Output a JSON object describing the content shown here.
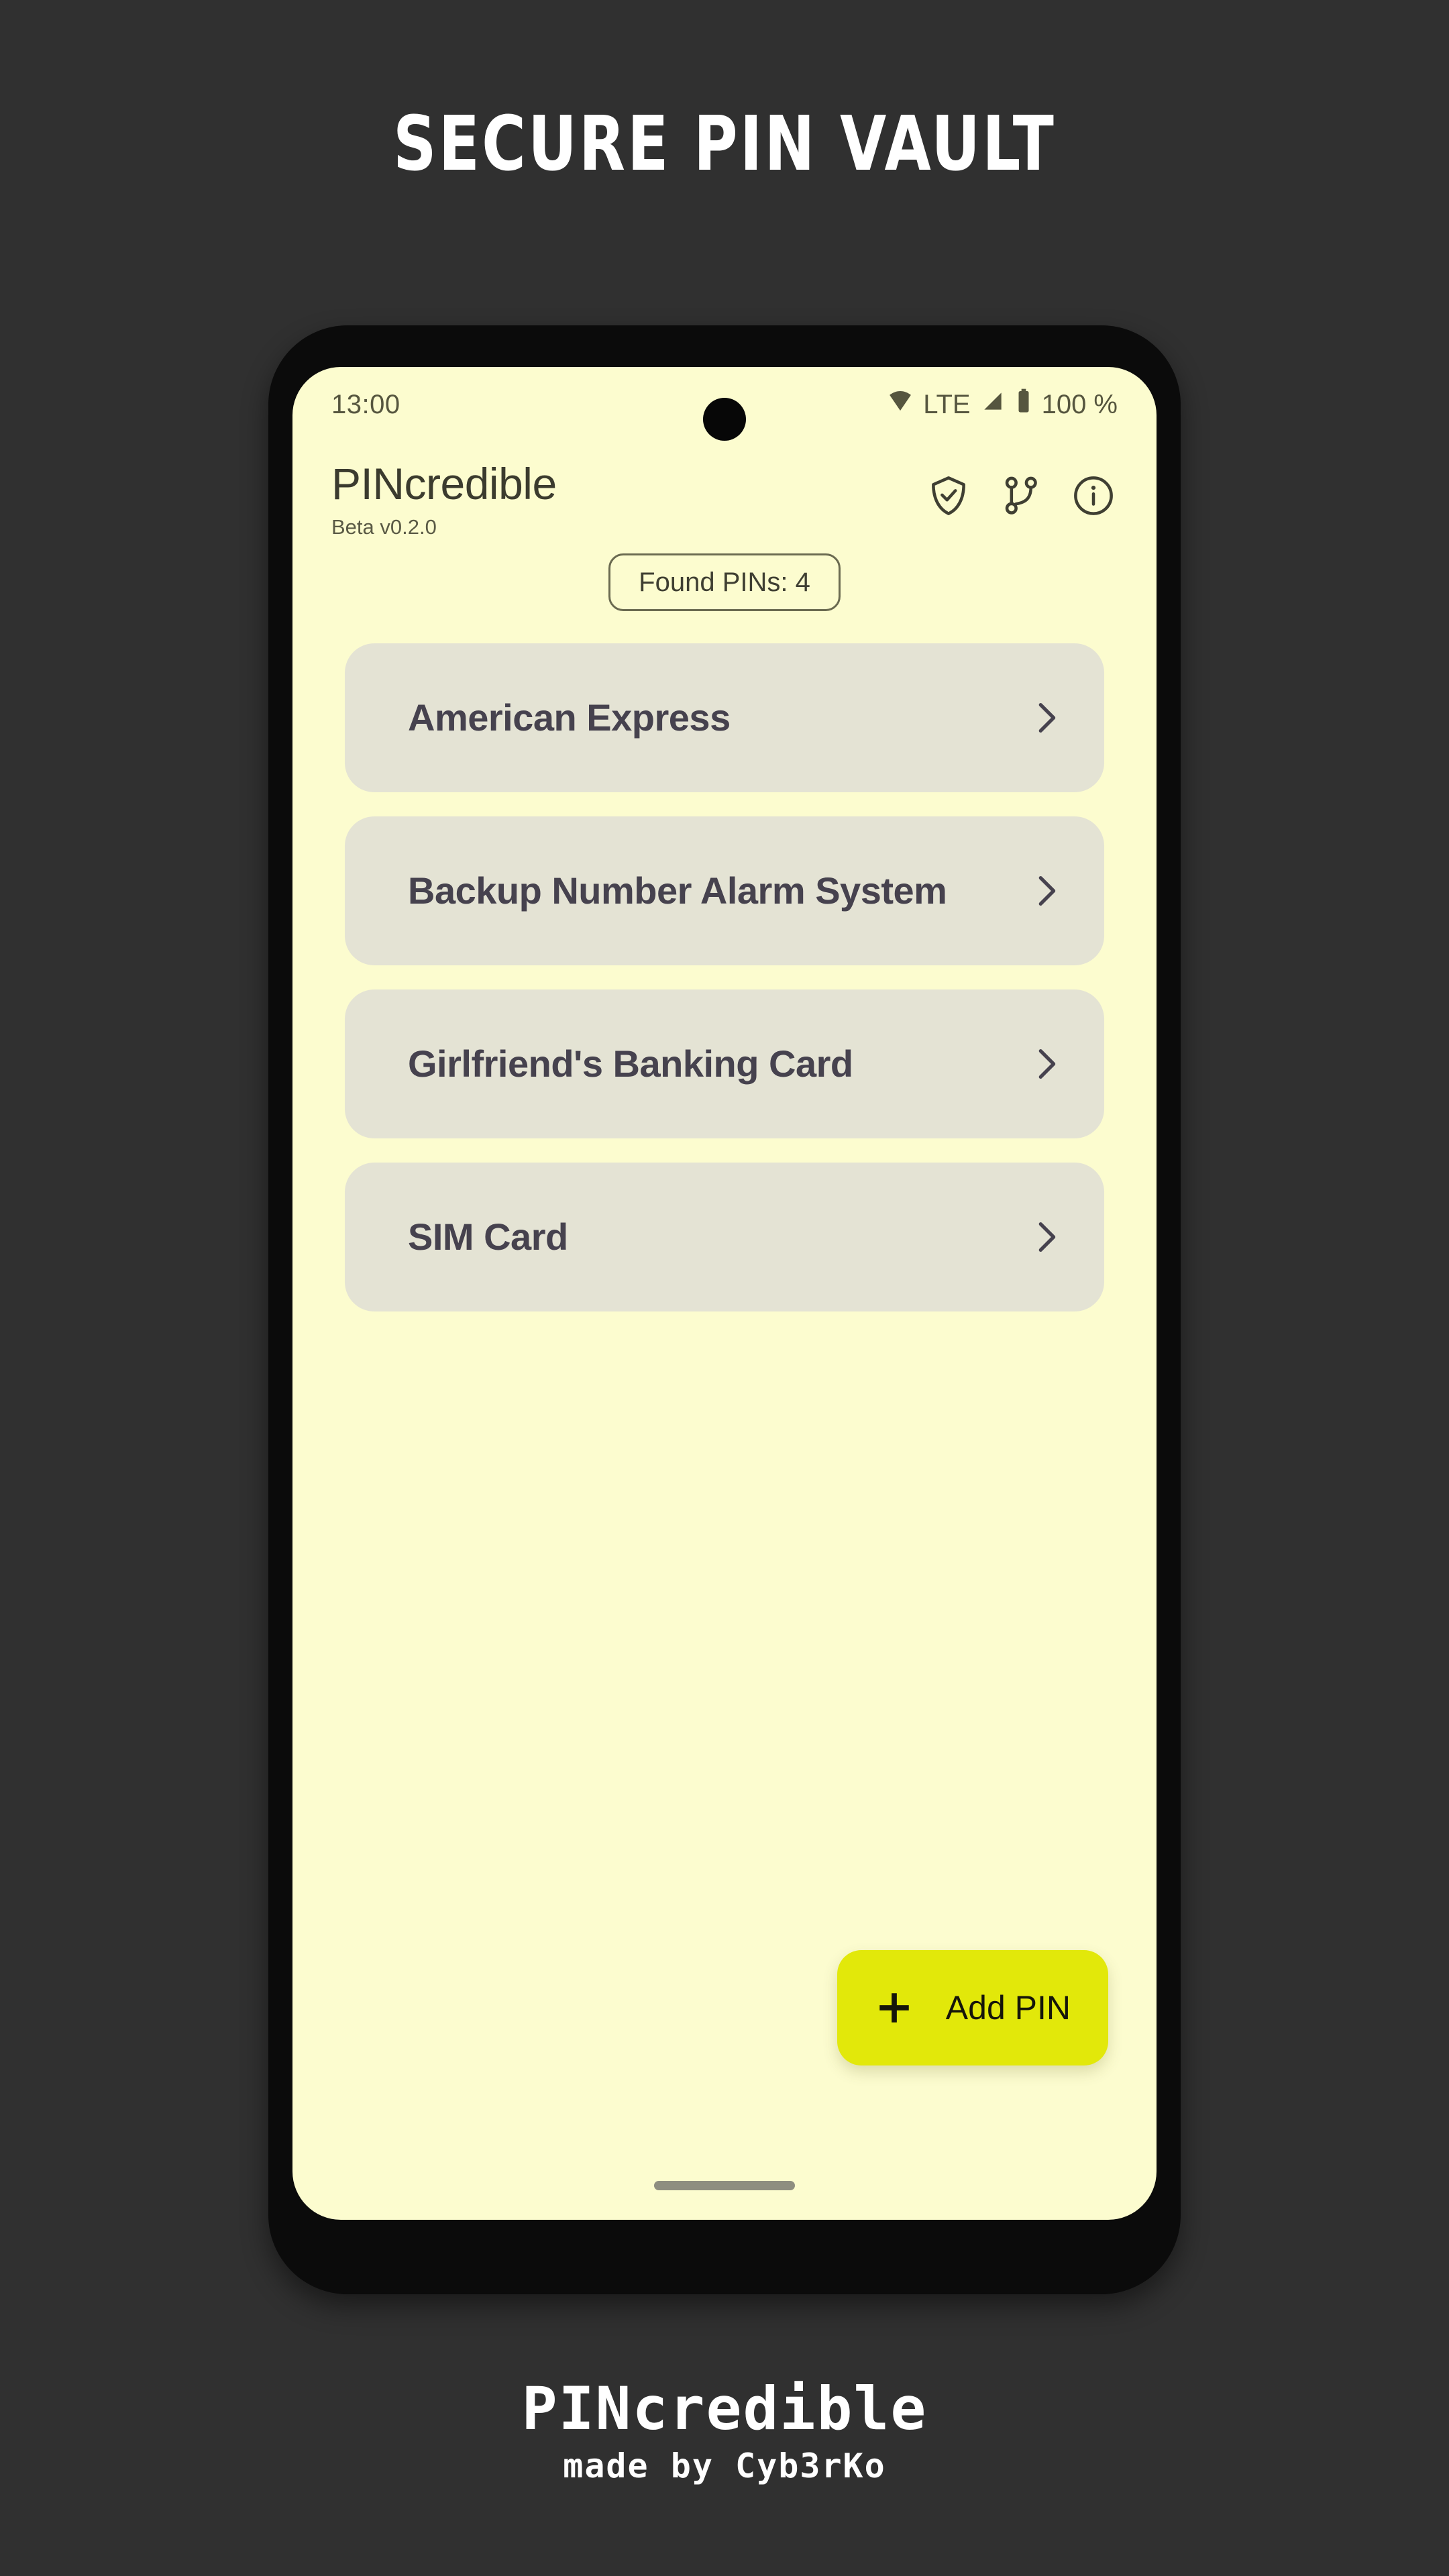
{
  "poster": {
    "title": "SECURE PIN VAULT",
    "background_color": "#303030",
    "footer_title": "PINcredible",
    "footer_subtitle": "made by Cyb3rKo"
  },
  "phone": {
    "frame_color": "#0b0b0b",
    "screen_background": "#fcfccf"
  },
  "status_bar": {
    "time": "13:00",
    "network_label": "LTE",
    "battery_label": "100 %",
    "icons": [
      "wifi-icon",
      "signal-icon",
      "battery-icon"
    ]
  },
  "app_bar": {
    "app_name": "PINcredible",
    "version": "Beta v0.2.0",
    "actions": [
      {
        "name": "shield-check-icon",
        "label": "Security"
      },
      {
        "name": "git-branch-icon",
        "label": "Source"
      },
      {
        "name": "info-circle-icon",
        "label": "About"
      }
    ]
  },
  "chip": {
    "label": "Found PINs: 4"
  },
  "pin_list": {
    "items": [
      {
        "title": "American Express"
      },
      {
        "title": "Backup Number Alarm System"
      },
      {
        "title": "Girlfriend's Banking Card"
      },
      {
        "title": "SIM Card"
      }
    ],
    "card_color": "#e4e3d4",
    "title_color": "#46424e"
  },
  "fab": {
    "label": "Add PIN",
    "icon": "plus-icon",
    "color": "#e2e80a"
  }
}
